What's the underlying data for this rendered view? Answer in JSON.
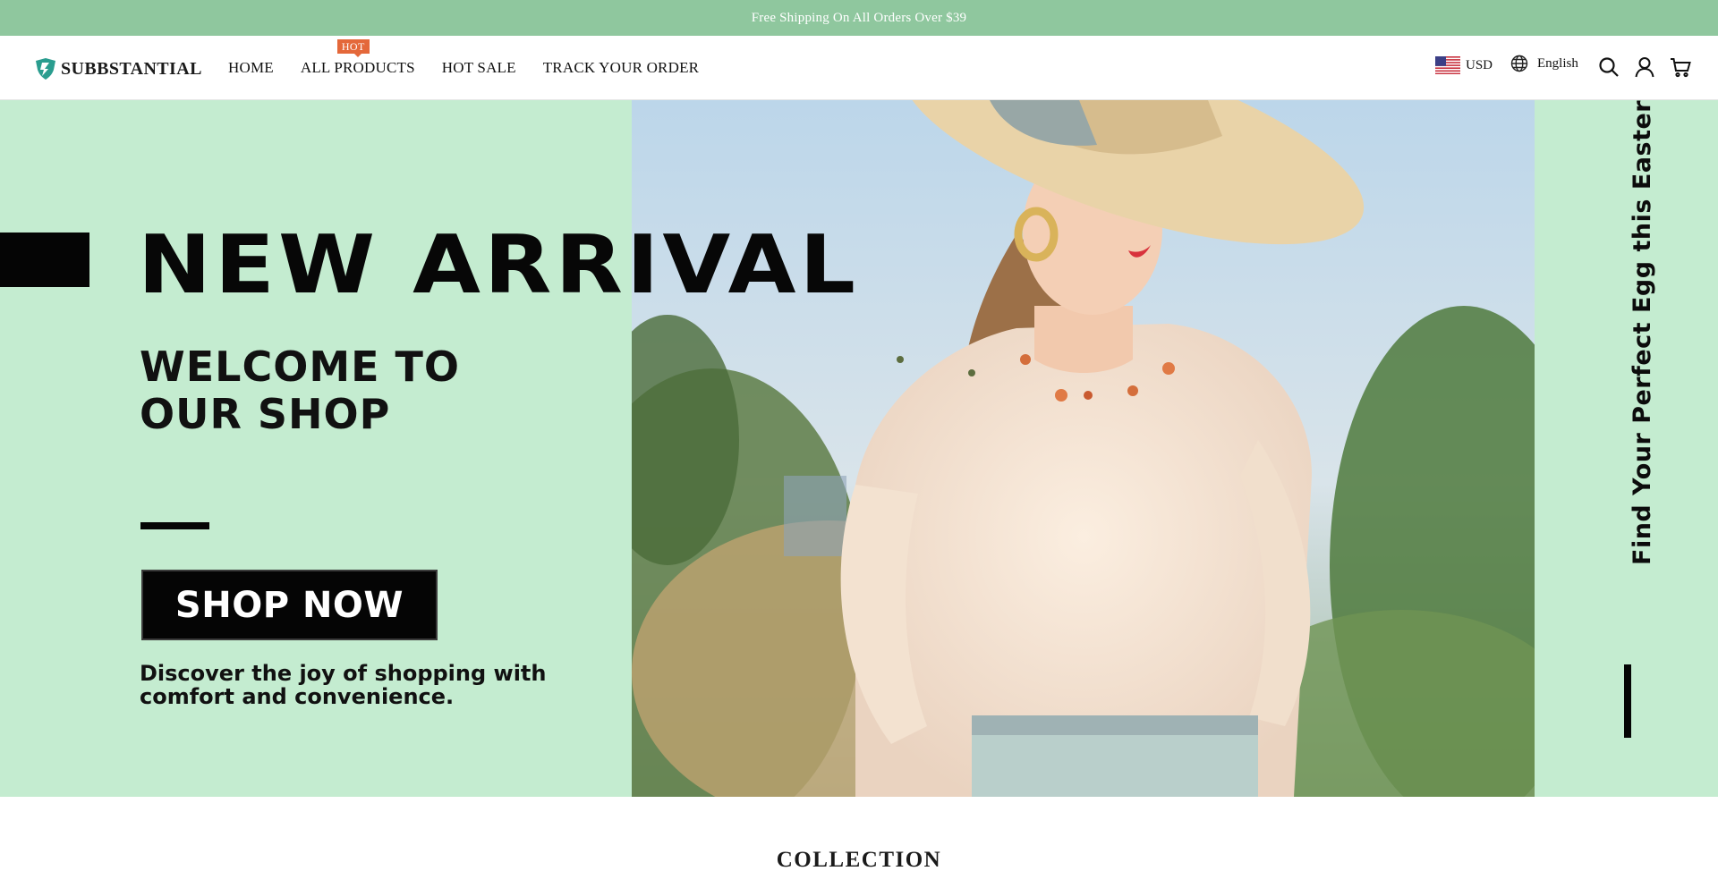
{
  "announcement": {
    "text": "Free Shipping On All Orders Over $39"
  },
  "header": {
    "logo_text": "SUBBSTANTIAL",
    "nav": [
      {
        "label": "HOME"
      },
      {
        "label": "ALL PRODUCTS",
        "badge": "HOT"
      },
      {
        "label": "HOT SALE"
      },
      {
        "label": "TRACK YOUR ORDER"
      }
    ],
    "currency": "USD",
    "language": "English",
    "icons": [
      "us-flag-icon",
      "globe-icon",
      "search-icon",
      "account-icon",
      "cart-icon"
    ]
  },
  "hero": {
    "title": "NEW ARRIVAL",
    "welcome_line1": "WELCOME TO",
    "welcome_line2": "OUR SHOP",
    "cta_label": "SHOP NOW",
    "tagline_line1": "Discover the joy of shopping with",
    "tagline_line2": "comfort and convenience.",
    "vertical_text": "Find Your Perfect Egg this Easter",
    "background_color": "#c4ecd0"
  },
  "collection": {
    "title": "COLLECTION"
  },
  "colors": {
    "announcement_bg": "#8fc79e",
    "hot_badge": "#e4683a",
    "logo_teal": "#2a9d8f"
  }
}
